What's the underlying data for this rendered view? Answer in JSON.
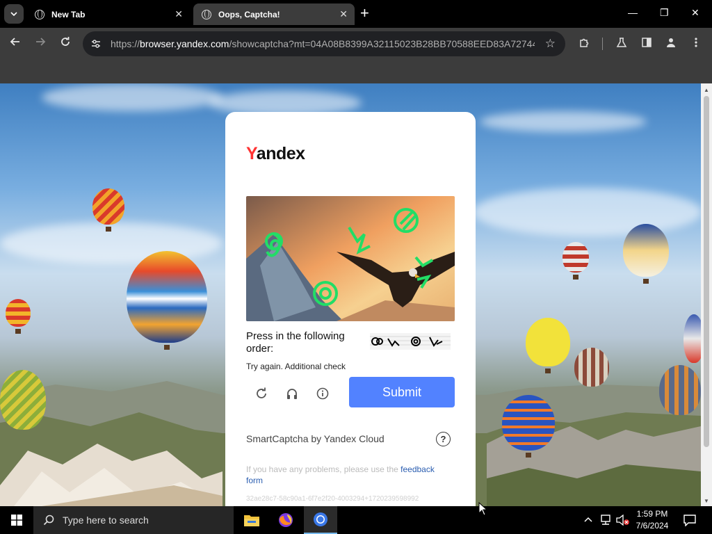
{
  "tabs": [
    {
      "title": "New Tab",
      "active": false
    },
    {
      "title": "Oops, Captcha!",
      "active": true
    }
  ],
  "address": {
    "scheme": "https://",
    "host": "browser.yandex.com",
    "path": "/showcaptcha?mt=04A08B8399A32115023B28BB70588EED83A72744..."
  },
  "captcha": {
    "logo_first": "Y",
    "logo_rest": "andex",
    "instruction": "Press in the following order:",
    "error": "Try again. Additional check",
    "submit_label": "Submit",
    "branding": "SmartCaptcha by Yandex Cloud",
    "help_glyph": "?",
    "problems_text": "If you have any problems, please use the ",
    "feedback_link": "feedback form",
    "token": "32ae28c7-58c90a1-6f7e2f20-4003294+1720239598992"
  },
  "taskbar": {
    "search_placeholder": "Type here to search",
    "time": "1:59 PM",
    "date": "7/6/2024"
  },
  "colors": {
    "submit": "#5282ff",
    "logo_y": "#ff3333",
    "captcha_marks": "#22dd66"
  },
  "icons": [
    "chevron-down-icon",
    "globe-icon",
    "close-icon",
    "plus-icon",
    "minimize-icon",
    "restore-icon",
    "back-icon",
    "forward-icon",
    "reload-icon",
    "site-info-icon",
    "star-icon",
    "extensions-icon",
    "labs-icon",
    "side-panel-icon",
    "profile-icon",
    "kebab-menu-icon",
    "refresh-icon",
    "headphones-icon",
    "info-icon",
    "help-icon",
    "windows-start-icon",
    "search-icon",
    "file-explorer-icon",
    "firefox-icon",
    "chrome-icon",
    "chevron-up-icon",
    "network-icon",
    "volume-icon",
    "notifications-icon"
  ]
}
